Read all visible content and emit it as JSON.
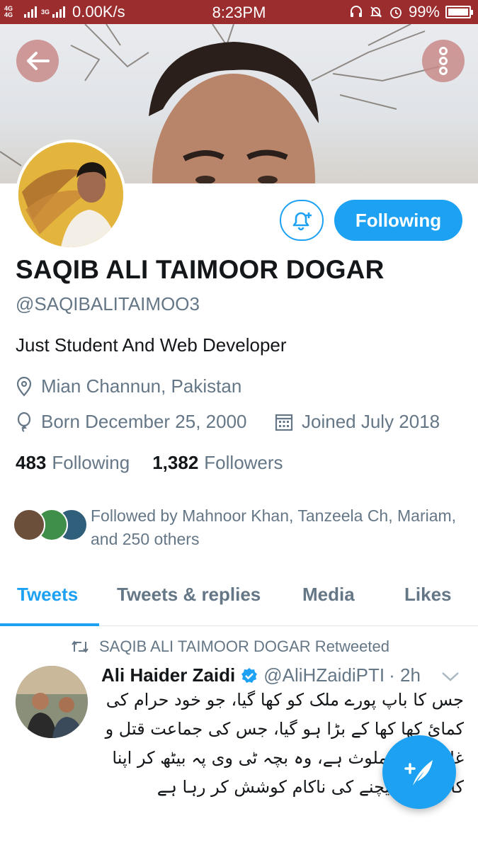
{
  "status_bar": {
    "network_1": "4G 4G",
    "network_2": "3G",
    "speed": "0.00K/s",
    "time": "8:23PM",
    "battery": "99%",
    "battery_level": 0.99
  },
  "header": {
    "back_icon": "arrow-left-icon",
    "more_icon": "more-vertical-icon"
  },
  "profile": {
    "name": "SAQIB ALI TAIMOOR DOGAR",
    "handle": "@SAQIBALITAIMOO3",
    "bio": "Just Student And Web Developer",
    "location": "Mian Channun, Pakistan",
    "born": "Born December 25, 2000",
    "joined": "Joined July 2018",
    "following_count": "483",
    "following_label": "Following",
    "followers_count": "1,382",
    "followers_label": "Followers",
    "followed_by": "Followed by Mahnoor Khan, Tanzeela Ch, Mariam, and 250 others",
    "following_button": "Following"
  },
  "tabs": [
    {
      "label": "Tweets",
      "active": true
    },
    {
      "label": "Tweets & replies",
      "active": false
    },
    {
      "label": "Media",
      "active": false
    },
    {
      "label": "Likes",
      "active": false
    }
  ],
  "tweet": {
    "retweet_label": "SAQIB ALI TAIMOOR DOGAR Retweeted",
    "author_name": "Ali Haider Zaidi",
    "author_handle": "@AliHZaidiPTI",
    "time": "· 2h",
    "text": "جس کا باپ پورے ملک کو کھا گیا، جو خود حرام کی کمائ کھا کھا کے بڑا ہو گیا، جس کی جماعت قتل و غارت میں ملوث ہے، وہ بچہ ٹی وی پہ بیٹھ کر اپنا کا بھاشن بیچنے کی ناکام کوشش کر رہا ہے"
  },
  "colors": {
    "accent": "#1da1f2",
    "status_bar": "#9b2d2f",
    "secondary_text": "#657786"
  }
}
